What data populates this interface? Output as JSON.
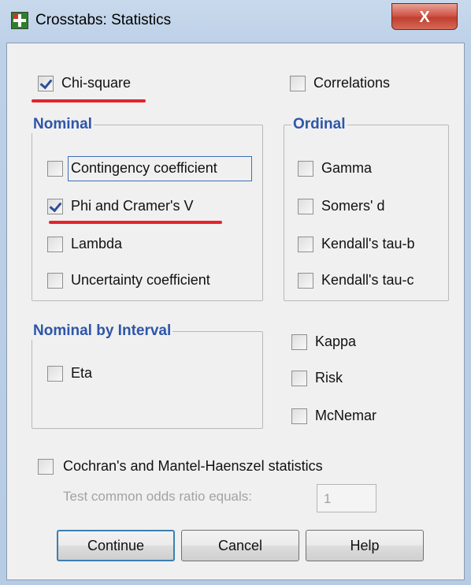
{
  "window": {
    "title": "Crosstabs: Statistics",
    "close_label": "X"
  },
  "top": {
    "chi_square": {
      "label": "Chi-square",
      "checked": true
    },
    "correlations": {
      "label": "Correlations",
      "checked": false
    }
  },
  "nominal": {
    "legend": "Nominal",
    "items": [
      {
        "label": "Contingency coefficient",
        "checked": false
      },
      {
        "label": "Phi and Cramer's V",
        "checked": true
      },
      {
        "label": "Lambda",
        "checked": false
      },
      {
        "label": "Uncertainty coefficient",
        "checked": false
      }
    ]
  },
  "ordinal": {
    "legend": "Ordinal",
    "items": [
      {
        "label": "Gamma",
        "checked": false
      },
      {
        "label": "Somers' d",
        "checked": false
      },
      {
        "label": "Kendall's tau-b",
        "checked": false
      },
      {
        "label": "Kendall's tau-c",
        "checked": false
      }
    ]
  },
  "nominal_by_interval": {
    "legend": "Nominal by Interval",
    "items": [
      {
        "label": "Eta",
        "checked": false
      }
    ]
  },
  "other": {
    "items": [
      {
        "label": "Kappa",
        "checked": false
      },
      {
        "label": "Risk",
        "checked": false
      },
      {
        "label": "McNemar",
        "checked": false
      }
    ]
  },
  "cochran": {
    "label": "Cochran's and Mantel-Haenszel statistics",
    "checked": false,
    "odds_label": "Test common odds ratio equals:",
    "odds_value": "1"
  },
  "buttons": {
    "continue": "Continue",
    "cancel": "Cancel",
    "help": "Help"
  },
  "colors": {
    "legend": "#2e56a8",
    "annotation_underline": "#e6232a",
    "close_button": "#c03f30"
  }
}
